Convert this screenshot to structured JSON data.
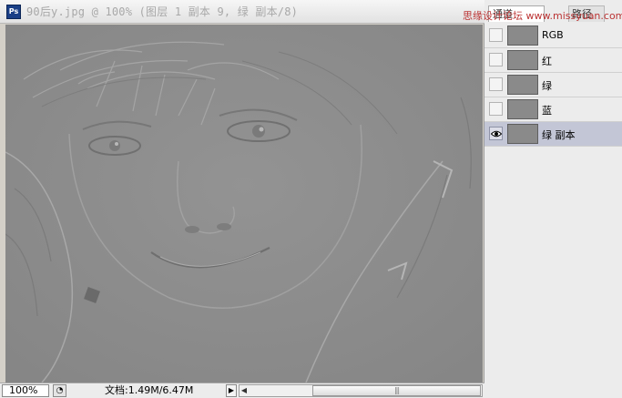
{
  "document": {
    "title": "90后y.jpg @ 100% (图层 1 副本 9, 绿 副本/8)",
    "app_icon": "photoshop-icon",
    "app_icon_text": "Ps"
  },
  "statusbar": {
    "zoom": "100%",
    "doc_size": "文档:1.49M/6.47M"
  },
  "panel": {
    "tabs": [
      {
        "label": "通道"
      },
      {
        "label": "路径"
      }
    ],
    "watermark": "思缘设计论坛 www.missyuan.com",
    "channels": [
      {
        "label": "RGB",
        "visible": false,
        "selected": false
      },
      {
        "label": "红",
        "visible": false,
        "selected": false
      },
      {
        "label": "绿",
        "visible": false,
        "selected": false
      },
      {
        "label": "蓝",
        "visible": false,
        "selected": false
      },
      {
        "label": "绿 副本",
        "visible": true,
        "selected": true
      }
    ]
  },
  "colors": {
    "canvas_gray": "#8d8d8d",
    "selected_row": "#c3c6d6",
    "panel_bg": "#ececec"
  }
}
